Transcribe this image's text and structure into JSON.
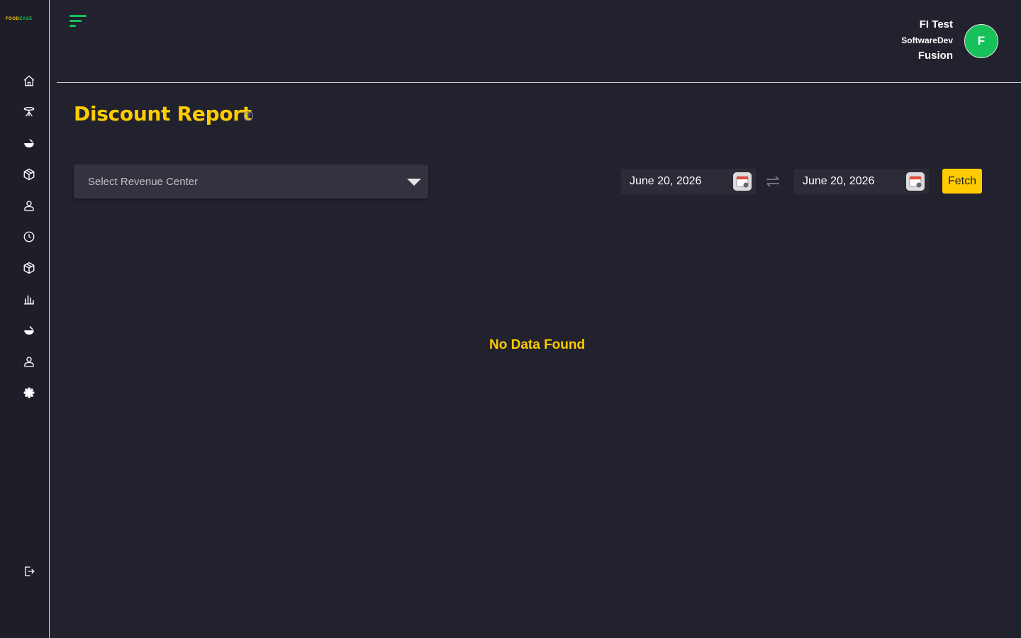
{
  "brand": {
    "logo_part1": "FOOD",
    "logo_part2": "EASE"
  },
  "colors": {
    "accent_yellow": "#ffcc00",
    "accent_green": "#16c15a",
    "background": "#22222e"
  },
  "sidebar": {
    "items": [
      {
        "name": "home-icon"
      },
      {
        "name": "table-icon"
      },
      {
        "name": "food-icon"
      },
      {
        "name": "package-icon"
      },
      {
        "name": "user-icon"
      },
      {
        "name": "clock-icon"
      },
      {
        "name": "box-icon"
      },
      {
        "name": "bar-chart-icon"
      },
      {
        "name": "food-bowl-icon"
      },
      {
        "name": "customer-icon"
      },
      {
        "name": "settings-gear-icon"
      }
    ],
    "logout_icon": "logout-icon"
  },
  "header": {
    "user_line1": "FI Test",
    "user_line2": "SoftwareDev",
    "user_line3": "Fusion",
    "avatar_initial": "F"
  },
  "page": {
    "title": "Discount Report"
  },
  "filters": {
    "revenue_center_placeholder": "Select Revenue Center",
    "start_date": "June 20, 2026",
    "end_date": "June 20, 2026",
    "fetch_label": "Fetch"
  },
  "results": {
    "empty_message": "No Data Found"
  }
}
